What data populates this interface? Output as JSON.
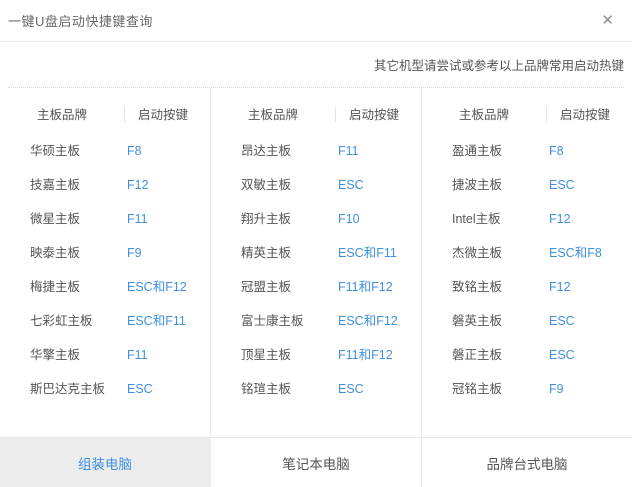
{
  "window": {
    "title": "一键U盘启动快捷键查询",
    "close_icon": "✕"
  },
  "note": "其它机型请尝试或参考以上品牌常用启动热键",
  "table": {
    "columns": [
      {
        "header": {
          "brand": "主板品牌",
          "key": "启动按键"
        },
        "rows": [
          {
            "brand": "华硕主板",
            "key": "F8"
          },
          {
            "brand": "技嘉主板",
            "key": "F12"
          },
          {
            "brand": "微星主板",
            "key": "F11"
          },
          {
            "brand": "映泰主板",
            "key": "F9"
          },
          {
            "brand": "梅捷主板",
            "key": "ESC和F12"
          },
          {
            "brand": "七彩虹主板",
            "key": "ESC和F11"
          },
          {
            "brand": "华擎主板",
            "key": "F11"
          },
          {
            "brand": "斯巴达克主板",
            "key": "ESC"
          }
        ]
      },
      {
        "header": {
          "brand": "主板品牌",
          "key": "启动按键"
        },
        "rows": [
          {
            "brand": "昂达主板",
            "key": "F11"
          },
          {
            "brand": "双敏主板",
            "key": "ESC"
          },
          {
            "brand": "翔升主板",
            "key": "F10"
          },
          {
            "brand": "精英主板",
            "key": "ESC和F11"
          },
          {
            "brand": "冠盟主板",
            "key": "F11和F12"
          },
          {
            "brand": "富士康主板",
            "key": "ESC和F12"
          },
          {
            "brand": "顶星主板",
            "key": "F11和F12"
          },
          {
            "brand": "铭瑄主板",
            "key": "ESC"
          }
        ]
      },
      {
        "header": {
          "brand": "主板品牌",
          "key": "启动按键"
        },
        "rows": [
          {
            "brand": "盈通主板",
            "key": "F8"
          },
          {
            "brand": "捷波主板",
            "key": "ESC"
          },
          {
            "brand": "Intel主板",
            "key": "F12"
          },
          {
            "brand": "杰微主板",
            "key": "ESC和F8"
          },
          {
            "brand": "致铭主板",
            "key": "F12"
          },
          {
            "brand": "磐英主板",
            "key": "ESC"
          },
          {
            "brand": "磐正主板",
            "key": "ESC"
          },
          {
            "brand": "冠铭主板",
            "key": "F9"
          }
        ]
      }
    ]
  },
  "tabs": [
    {
      "name": "assembled-pc",
      "label": "组装电脑",
      "active": true
    },
    {
      "name": "laptop",
      "label": "笔记本电脑",
      "active": false
    },
    {
      "name": "brand-desktop",
      "label": "品牌台式电脑",
      "active": false
    }
  ],
  "colors": {
    "accent": "#4090E0",
    "text_primary": "#555555",
    "text_title": "#666666",
    "active_tab_bg": "#ECECEC",
    "divider": "#E8E8E8"
  }
}
